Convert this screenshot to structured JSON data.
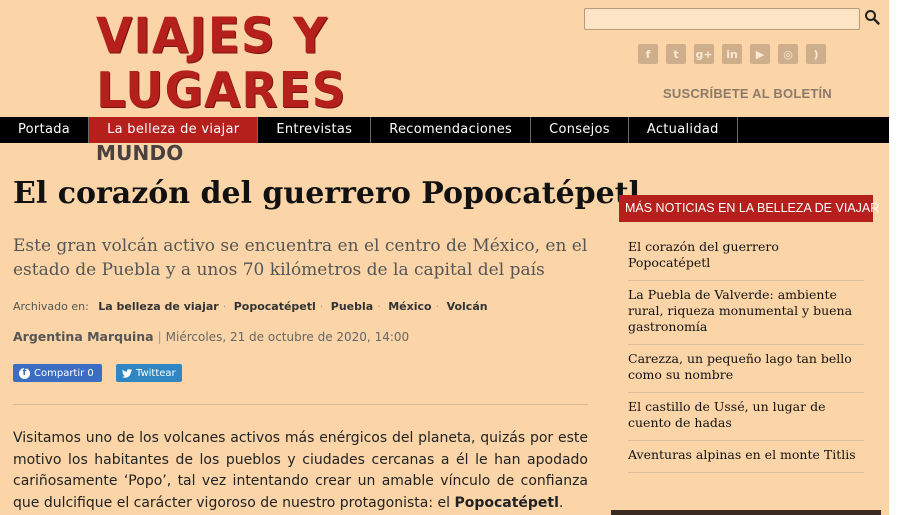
{
  "header": {
    "logo_title": "VIAJES Y LUGARES",
    "logo_subtitle": "DESCUBRIENDO EL ENCANTO DEL MUNDO",
    "search_placeholder": "",
    "newsletter": "SUSCRÍBETE AL BOLETÍN",
    "social": [
      {
        "icon": "facebook-icon",
        "glyph": "f"
      },
      {
        "icon": "twitter-icon",
        "glyph": "t"
      },
      {
        "icon": "google-plus-icon",
        "glyph": "g+"
      },
      {
        "icon": "linkedin-icon",
        "glyph": "in"
      },
      {
        "icon": "youtube-icon",
        "glyph": "▶"
      },
      {
        "icon": "instagram-icon",
        "glyph": "◎"
      },
      {
        "icon": "rss-icon",
        "glyph": ")"
      }
    ]
  },
  "nav": {
    "items": [
      {
        "label": "Portada",
        "active": false
      },
      {
        "label": "La belleza de viajar",
        "active": true
      },
      {
        "label": "Entrevistas",
        "active": false
      },
      {
        "label": "Recomendaciones",
        "active": false
      },
      {
        "label": "Consejos",
        "active": false
      },
      {
        "label": "Actualidad",
        "active": false
      }
    ]
  },
  "article": {
    "title": "El corazón del guerrero Popocatépetl",
    "subtitle": "Este gran volcán activo se encuentra en el centro de México, en el estado de Puebla y a unos 70 kilómetros de la capital del país",
    "archived_label": "Archivado en:",
    "tags": [
      "La belleza de viajar",
      "Popocatépetl",
      "Puebla",
      "México",
      "Volcán"
    ],
    "author": "Argentina Marquina",
    "date": "Miércoles, 21 de octubre de 2020, 14:00",
    "share_facebook": "Compartir 0",
    "share_twitter": "Twittear",
    "body_intro": "Visitamos uno de los volcanes activos más enérgicos del planeta, quizás por este motivo los habitantes de los pueblos y ciudades cercanas a él le han apodado cariñosamente ‘Popo’, tal vez intentando crear un amable vínculo de confianza que dulcifique el carácter vigoroso de nuestro protagonista: el ",
    "body_bold": "Popocatépetl",
    "body_end": "."
  },
  "sidebar": {
    "heading": "MÁS NOTICIAS EN LA BELLEZA DE VIAJAR",
    "items": [
      "El corazón del guerrero Popocatépetl",
      "La Puebla de Valverde: ambiente rural, riqueza monumental y buena gastronomía",
      "Carezza, un pequeño lago tan bello como su nombre",
      "El castillo de Ussé, un lugar de cuento de hadas",
      "Aventuras alpinas en el monte Titlis"
    ]
  },
  "colors": {
    "background": "#fbd5a8",
    "accent": "#b5201c",
    "nav_bg": "#000000"
  }
}
